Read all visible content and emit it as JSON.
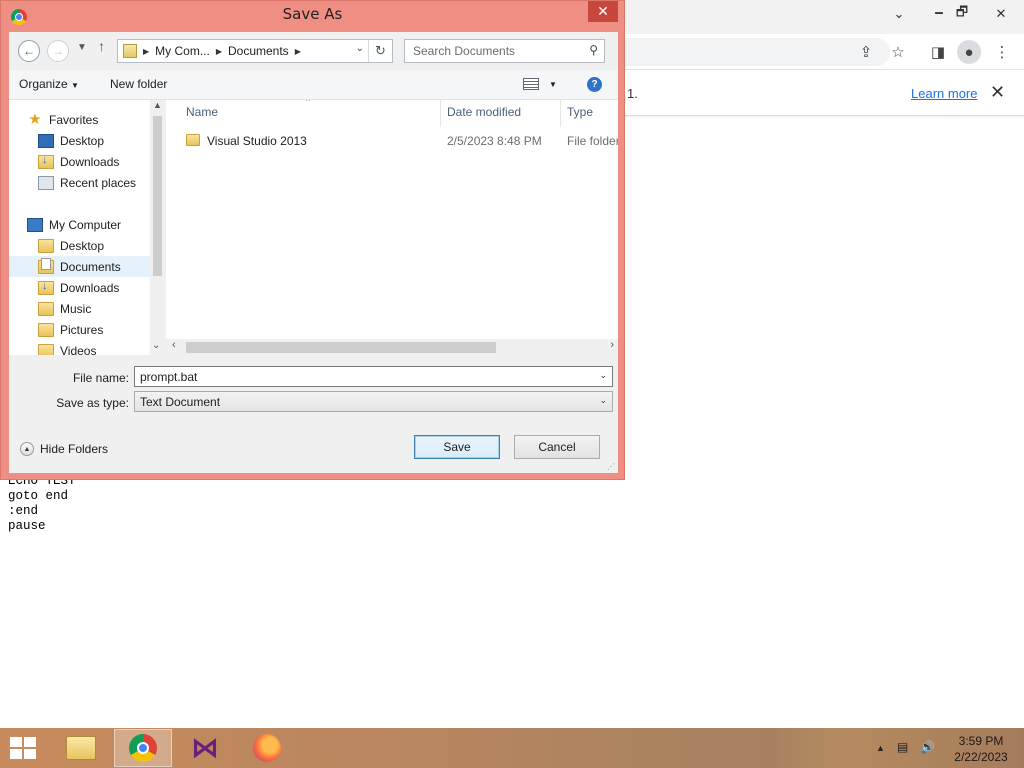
{
  "chrome": {
    "window_controls": {
      "minimize": "🗕",
      "restore": "🗗",
      "close": "✕",
      "dropdown": "⌄"
    },
    "infobar": {
      "text": "1.",
      "learn_more": "Learn more",
      "close": "✕"
    }
  },
  "editor_text": "ECHO TEST\ngoto end\n:end\npause",
  "dialog": {
    "title": "Save As",
    "close": "✕",
    "address": {
      "crumbs": [
        "My Com...",
        "Documents"
      ]
    },
    "search": {
      "placeholder": "Search Documents"
    },
    "commands": {
      "organize": "Organize",
      "new_folder": "New folder"
    },
    "nav_pane": {
      "items": [
        {
          "label": "Favorites",
          "icon": "star-icon"
        },
        {
          "label": "Desktop",
          "icon": "desktop-icon"
        },
        {
          "label": "Downloads",
          "icon": "downloads-icon"
        },
        {
          "label": "Recent places",
          "icon": "recent-places-icon"
        },
        {
          "label": "My Computer",
          "icon": "computer-icon"
        },
        {
          "label": "Desktop",
          "icon": "desktop-icon"
        },
        {
          "label": "Documents",
          "icon": "documents-icon",
          "selected": true
        },
        {
          "label": "Downloads",
          "icon": "downloads-icon"
        },
        {
          "label": "Music",
          "icon": "music-folder-icon"
        },
        {
          "label": "Pictures",
          "icon": "pictures-folder-icon"
        },
        {
          "label": "Videos",
          "icon": "videos-folder-icon"
        }
      ]
    },
    "file_list": {
      "columns": [
        "Name",
        "Date modified",
        "Type"
      ],
      "rows": [
        {
          "name": "Visual Studio 2013",
          "date": "2/5/2023 8:48 PM",
          "type": "File folder"
        }
      ]
    },
    "file_name": {
      "label": "File name:",
      "value": "prompt.bat"
    },
    "save_as_type": {
      "label": "Save as type:",
      "value": "Text Document"
    },
    "hide_folders": "Hide Folders",
    "buttons": {
      "save": "Save",
      "cancel": "Cancel"
    }
  },
  "taskbar": {
    "apps": [
      "file-explorer-icon",
      "chrome-icon",
      "visual-studio-icon",
      "firefox-icon"
    ],
    "active_app": "chrome-icon",
    "clock": {
      "time": "3:59 PM",
      "date": "2/22/2023"
    }
  }
}
